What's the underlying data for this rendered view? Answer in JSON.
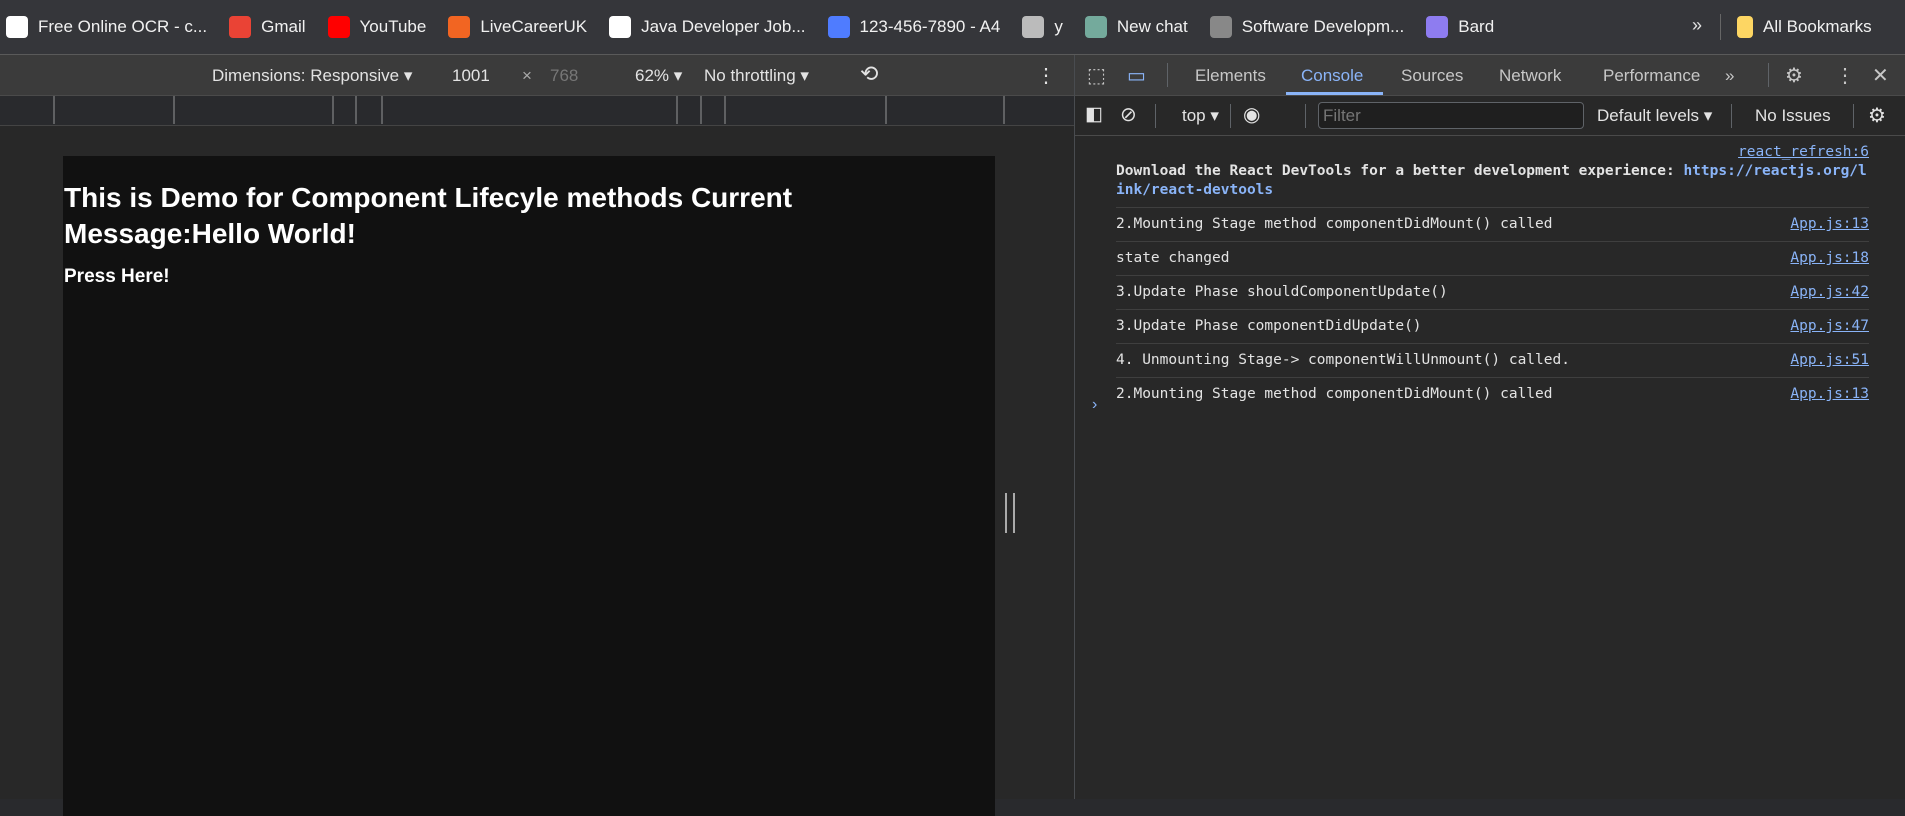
{
  "bookmarks": [
    {
      "label": "Free Online OCR - c...",
      "icon": "ocr-icon",
      "color": "#ffffff"
    },
    {
      "label": "Gmail",
      "icon": "gmail-icon",
      "color": "#ea4335"
    },
    {
      "label": "YouTube",
      "icon": "youtube-icon",
      "color": "#ff0000"
    },
    {
      "label": "LiveCareerUK",
      "icon": "livecareer-icon",
      "color": "#f26522"
    },
    {
      "label": "Java Developer Job...",
      "icon": "shine-icon",
      "color": "#ffffff"
    },
    {
      "label": "123-456-7890 - A4",
      "icon": "printer-icon",
      "color": "#4f7cff"
    },
    {
      "label": "y",
      "icon": "globe-icon",
      "color": "#bbbbbb"
    },
    {
      "label": "New chat",
      "icon": "chatgpt-icon",
      "color": "#74aa9c"
    },
    {
      "label": "Software Developm...",
      "icon": "apple-icon",
      "color": "#888888"
    },
    {
      "label": "Bard",
      "icon": "bard-icon",
      "color": "#8e7cf0"
    }
  ],
  "bookmarks_more": "»",
  "all_bookmarks": "All Bookmarks",
  "device_toolbar": {
    "dimensions": "Dimensions: Responsive",
    "width": "1001",
    "x": "×",
    "height": "768",
    "zoom": "62%",
    "throttling": "No throttling"
  },
  "page": {
    "heading": "This is Demo for Component Lifecyle methods Current Message:Hello World!",
    "button": "Press Here!"
  },
  "devtools": {
    "tabs": [
      "Elements",
      "Console",
      "Sources",
      "Network",
      "Performance"
    ],
    "active_tab": "Console",
    "context": "top",
    "filter_placeholder": "Filter",
    "levels": "Default levels",
    "issues": "No Issues",
    "react_source": "react_refresh:6",
    "react_msg": "Download the React DevTools for a better development experience: ",
    "react_link": "https://reactjs.org/link/react-devtools",
    "messages": [
      {
        "text": "2.Mounting Stage method componentDidMount() called",
        "source": "App.js:13"
      },
      {
        "text": "state changed",
        "source": "App.js:18"
      },
      {
        "text": "3.Update Phase shouldComponentUpdate()",
        "source": "App.js:42"
      },
      {
        "text": "3.Update Phase componentDidUpdate()",
        "source": "App.js:47"
      },
      {
        "text": "4. Unmounting Stage-> componentWillUnmount() called.",
        "source": "App.js:51"
      },
      {
        "text": "2.Mounting Stage method componentDidMount() called",
        "source": "App.js:13"
      }
    ],
    "prompt": "›"
  }
}
